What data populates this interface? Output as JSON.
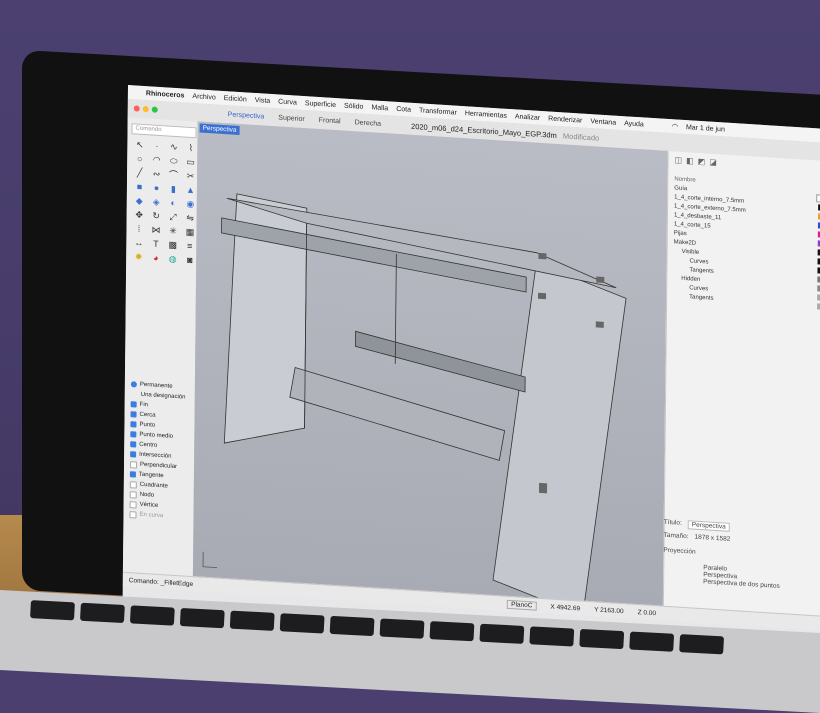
{
  "menubar": {
    "app": "Rhinoceros",
    "items": [
      "Archivo",
      "Edición",
      "Vista",
      "Curva",
      "Superficie",
      "Sólido",
      "Malla",
      "Cota",
      "Transformar",
      "Herramientas",
      "Analizar",
      "Renderizar",
      "Ventana",
      "Ayuda"
    ],
    "date": "Mar 1 de jun"
  },
  "window": {
    "tabs": [
      "Perspectiva",
      "Superior",
      "Frontal",
      "Derecha"
    ],
    "title": "2020_m06_d24_Escritorio_Mayo_EGP.3dm",
    "modified": "Modificado"
  },
  "toolbox": {
    "command_placeholder": "Comando",
    "icons": [
      "arrow",
      "point",
      "curve",
      "polyline",
      "circle",
      "arc",
      "ellipse",
      "rectangle",
      "line",
      "freeform",
      "fillet",
      "trim",
      "box",
      "sphere",
      "cylinder",
      "cone",
      "extrude",
      "loft",
      "sweep",
      "boolean",
      "move",
      "rotate",
      "scale",
      "mirror",
      "array",
      "join",
      "explode",
      "group",
      "dimension",
      "text",
      "hatch",
      "layer",
      "light",
      "render",
      "material",
      "camera"
    ]
  },
  "snaps": {
    "mode": "Permanente",
    "mode2": "Una designación",
    "items": [
      {
        "label": "Fin",
        "checked": true
      },
      {
        "label": "Cerca",
        "checked": true
      },
      {
        "label": "Punto",
        "checked": true
      },
      {
        "label": "Punto medio",
        "checked": true
      },
      {
        "label": "Centro",
        "checked": true
      },
      {
        "label": "Intersección",
        "checked": true
      },
      {
        "label": "Perpendicular",
        "checked": false
      },
      {
        "label": "Tangente",
        "checked": true
      },
      {
        "label": "Cuadrante",
        "checked": false
      },
      {
        "label": "Nodo",
        "checked": false
      },
      {
        "label": "Vértice",
        "checked": false
      },
      {
        "label": "En curva",
        "checked": false
      }
    ]
  },
  "viewport": {
    "label": "Perspectiva"
  },
  "layers": {
    "header": "Nombre",
    "items": [
      {
        "name": "Guía",
        "color": "#ffffff"
      },
      {
        "name": "1_4_corte_interno_7.5mm",
        "color": "#111111"
      },
      {
        "name": "1_4_corte_externo_7.5mm",
        "color": "#e8a21e"
      },
      {
        "name": "1_4_desbaste_11",
        "color": "#2b4bd6"
      },
      {
        "name": "1_4_corte_15",
        "color": "#d41f8c"
      },
      {
        "name": "Pijas",
        "color": "#8a3fd1"
      },
      {
        "name": "Make2D",
        "color": "#111111"
      },
      {
        "name": "Visible",
        "color": "#111111"
      },
      {
        "name": "Curves",
        "color": "#111111"
      },
      {
        "name": "Tangents",
        "color": "#777777"
      },
      {
        "name": "Hidden",
        "color": "#888888"
      },
      {
        "name": "Curves",
        "color": "#aaaaaa"
      },
      {
        "name": "Tangents",
        "color": "#aaaaaa"
      }
    ]
  },
  "properties": {
    "title_label": "Título:",
    "title_value": "Perspectiva",
    "size_label": "Tamaño:",
    "size_value": "1878 x 1582",
    "projection_label": "Proyección",
    "proj_options": [
      "Paralelo",
      "Perspectiva",
      "Perspectiva de dos puntos"
    ]
  },
  "status": {
    "command": "Comando: _FilletEdge",
    "plane": "PlanoC",
    "x": "X 4942.69",
    "y": "Y 2163.00",
    "z": "Z 0.00"
  }
}
